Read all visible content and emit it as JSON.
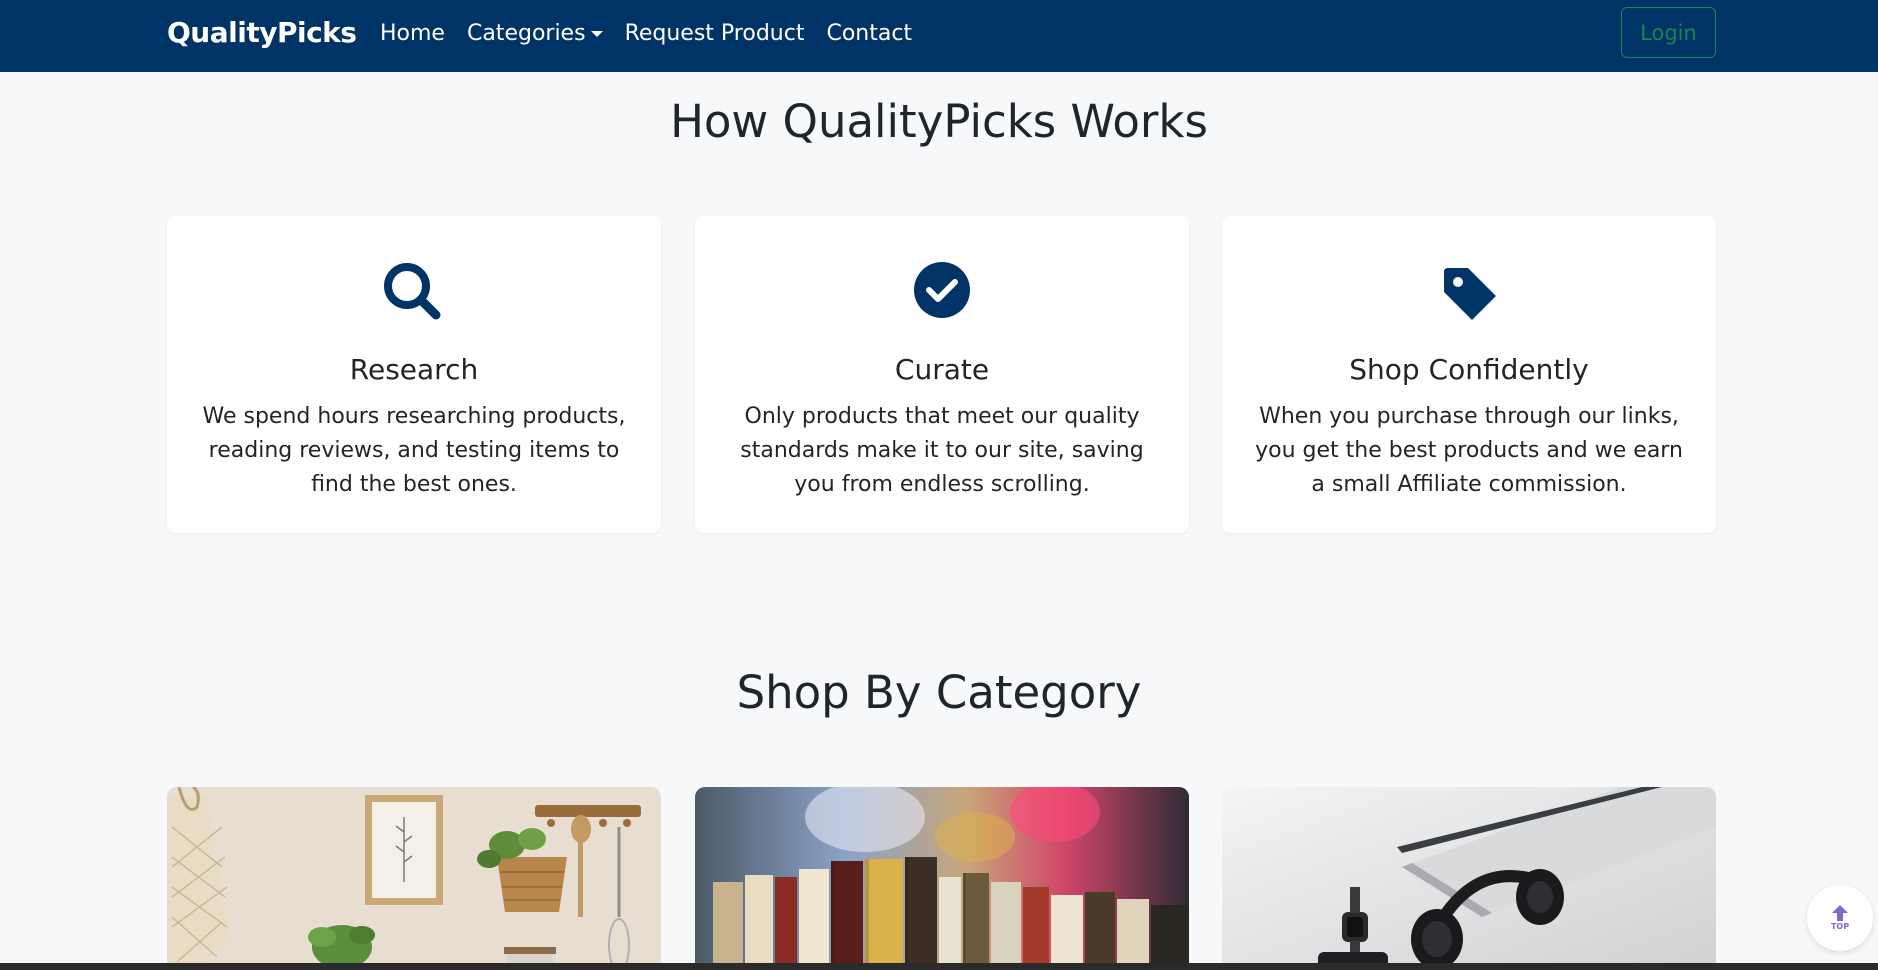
{
  "nav": {
    "brand": "QualityPicks",
    "links": [
      {
        "label": "Home"
      },
      {
        "label": "Categories",
        "dropdown": true
      },
      {
        "label": "Request Product"
      },
      {
        "label": "Contact"
      }
    ],
    "login_label": "Login"
  },
  "how": {
    "title": "How QualityPicks Works",
    "cards": [
      {
        "icon": "search-icon",
        "title": "Research",
        "text": "We spend hours researching products, reading reviews, and testing items to find the best ones."
      },
      {
        "icon": "check-circle-icon",
        "title": "Curate",
        "text": "Only products that meet our quality standards make it to our site, saving you from endless scrolling."
      },
      {
        "icon": "tag-icon",
        "title": "Shop Confidently",
        "text": "When you purchase through our links, you get the best products and we earn a small Affiliate commission."
      }
    ]
  },
  "categories": {
    "title": "Shop By Category",
    "items": [
      {
        "image": "home-decor-image"
      },
      {
        "image": "books-image"
      },
      {
        "image": "electronics-image"
      }
    ]
  },
  "top_button": {
    "label": "TOP"
  },
  "colors": {
    "nav_bg": "#003366",
    "accent": "#003366",
    "login": "#198754",
    "page_bg": "#f7f8fa"
  }
}
